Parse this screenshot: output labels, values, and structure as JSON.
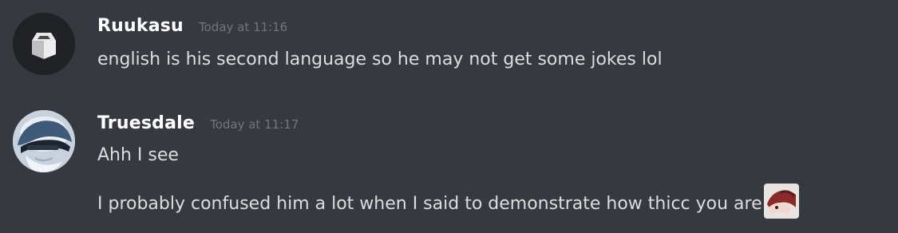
{
  "messages": [
    {
      "author": "Ruukasu",
      "timestamp": "Today at 11:16",
      "lines": [
        "english is his second language so he may not get some jokes lol"
      ]
    },
    {
      "author": "Truesdale",
      "timestamp": "Today at 11:17",
      "lines": [
        "Ahh I see",
        "I probably confused him a lot when I said to demonstrate how thicc you are"
      ],
      "emoji": "custom-emoji"
    }
  ]
}
